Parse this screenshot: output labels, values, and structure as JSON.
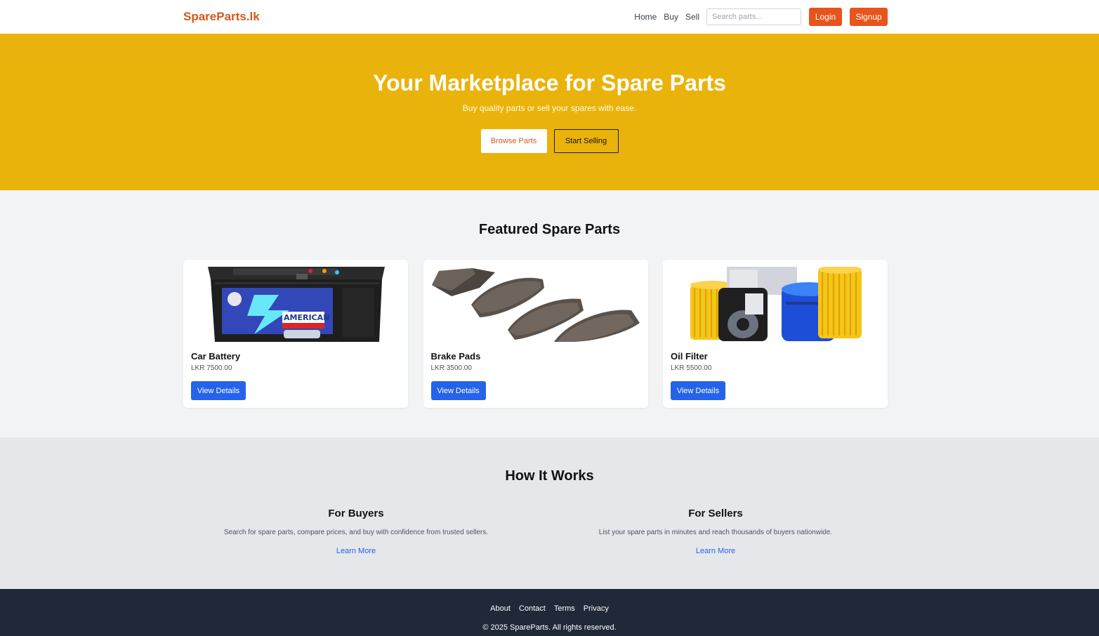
{
  "nav": {
    "brand": "SpareParts.lk",
    "links": [
      "Home",
      "Buy",
      "Sell"
    ],
    "search_placeholder": "Search parts...",
    "login_label": "Login",
    "signup_label": "Signup"
  },
  "hero": {
    "title": "Your Marketplace for Spare Parts",
    "subtitle": "Buy quality parts or sell your spares with ease.",
    "browse_label": "Browse Parts",
    "sell_label": "Start Selling"
  },
  "featured": {
    "heading": "Featured Spare Parts",
    "cards": [
      {
        "title": "Car Battery",
        "price": "LKR 7500.00",
        "button": "View Details",
        "image": "car-battery-image",
        "label_text": "AMERICAN"
      },
      {
        "title": "Brake Pads",
        "price": "LKR 3500.00",
        "button": "View Details",
        "image": "brake-pads-image"
      },
      {
        "title": "Oil Filter",
        "price": "LKR 5500.00",
        "button": "View Details",
        "image": "oil-filter-image"
      }
    ]
  },
  "how": {
    "heading": "How It Works",
    "buyers": {
      "title": "For Buyers",
      "text": "Search for spare parts, compare prices, and buy with confidence from trusted sellers.",
      "link": "Learn More"
    },
    "sellers": {
      "title": "For Sellers",
      "text": "List your spare parts in minutes and reach thousands of buyers nationwide.",
      "link": "Learn More"
    }
  },
  "footer": {
    "links": [
      "About",
      "Contact",
      "Terms",
      "Privacy"
    ],
    "copyright": "© 2025 SpareParts. All rights reserved."
  },
  "colors": {
    "brand_orange": "#e8541b",
    "hero_yellow": "#e9b30b",
    "link_blue": "#2563eb",
    "footer_dark": "#1f2937"
  }
}
